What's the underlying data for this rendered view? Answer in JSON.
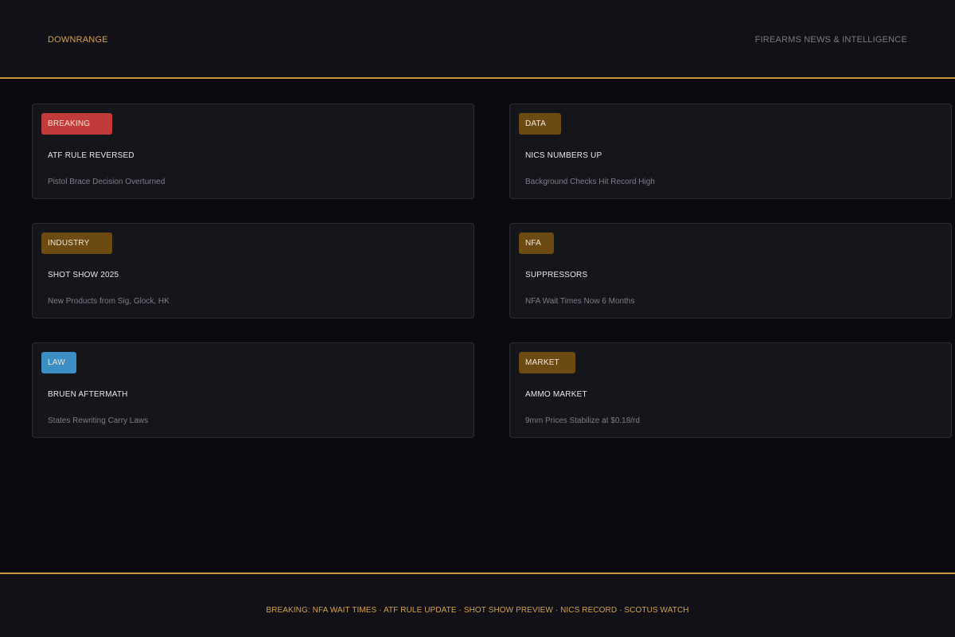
{
  "header": {
    "brand": "DOWNRANGE",
    "tagline": "FIREARMS NEWS & INTELLIGENCE"
  },
  "colors": {
    "accent": "#c8963e",
    "breaking": "#c23b3b",
    "category": "#6b4a14",
    "law": "#3b8fc2"
  },
  "cards": [
    {
      "badge": "BREAKING",
      "badge_color": "#c23b3b",
      "title": "ATF RULE REVERSED",
      "subtitle": "Pistol Brace Decision Overturned"
    },
    {
      "badge": "DATA",
      "badge_color": "#6b4a14",
      "title": "NICS NUMBERS UP",
      "subtitle": "Background Checks Hit Record High"
    },
    {
      "badge": "INDUSTRY",
      "badge_color": "#6b4a14",
      "title": "SHOT SHOW 2025",
      "subtitle": "New Products from Sig, Glock, HK"
    },
    {
      "badge": "NFA",
      "badge_color": "#6b4a14",
      "title": "SUPPRESSORS",
      "subtitle": "NFA Wait Times Now 6 Months"
    },
    {
      "badge": "LAW",
      "badge_color": "#3b8fc2",
      "title": "BRUEN AFTERMATH",
      "subtitle": "States Rewriting Carry Laws"
    },
    {
      "badge": "MARKET",
      "badge_color": "#6b4a14",
      "title": "AMMO MARKET",
      "subtitle": "9mm Prices Stabilize at $0.18/rd"
    }
  ],
  "footer": {
    "ticker": "BREAKING: NFA WAIT TIMES · ATF RULE UPDATE · SHOT SHOW PREVIEW · NICS RECORD · SCOTUS WATCH"
  }
}
